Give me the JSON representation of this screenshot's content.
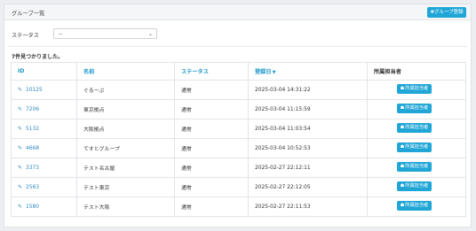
{
  "header": {
    "title": "グループ一覧",
    "register_button": "グループ登録",
    "register_icon": "plus-icon"
  },
  "filter": {
    "status_label": "ステータス",
    "status_selected": "--"
  },
  "result_count": "7件見つかりました。",
  "table": {
    "columns": [
      "ID",
      "名前",
      "ステータス",
      "登録日",
      "所属担当者"
    ],
    "sorted_column": "登録日",
    "sort_direction": "desc",
    "action_label": "所属担当者",
    "rows": [
      {
        "id": "10125",
        "name": "ぐるーぷ",
        "status": "通常",
        "registered": "2025-03-04 14:31:22"
      },
      {
        "id": "7206",
        "name": "東京拠点",
        "status": "通常",
        "registered": "2025-03-04 11:15:59"
      },
      {
        "id": "5132",
        "name": "大阪拠点",
        "status": "通常",
        "registered": "2025-03-04 11:03:54"
      },
      {
        "id": "4668",
        "name": "てすとグループ",
        "status": "通常",
        "registered": "2025-03-04 10:52:53"
      },
      {
        "id": "3373",
        "name": "テスト名古屋",
        "status": "通常",
        "registered": "2025-02-27 22:12:11"
      },
      {
        "id": "2563",
        "name": "テスト東京",
        "status": "通常",
        "registered": "2025-02-27 22:12:05"
      },
      {
        "id": "1580",
        "name": "テスト大阪",
        "status": "通常",
        "registered": "2025-02-27 22:11:53"
      }
    ]
  },
  "colors": {
    "accent": "#1fa6d6",
    "link": "#2e88c2",
    "background": "#eceef1"
  }
}
